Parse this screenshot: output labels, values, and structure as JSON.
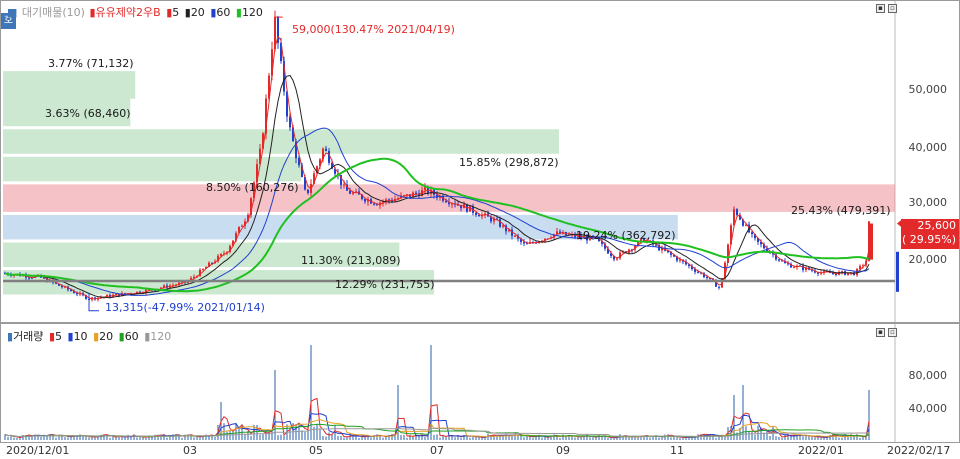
{
  "price_pane": {
    "legend": {
      "marker": "■",
      "title": "대기매물(10)",
      "stock": "유유제약2우B",
      "ma": [
        "5",
        "20",
        "60",
        "120"
      ],
      "ma_colors": [
        "#e22a2a",
        "#222222",
        "#2040d0",
        "#20c020"
      ]
    },
    "corner_label": "호",
    "y_ticks": [
      "50,000",
      "40,000",
      "30,000",
      "20,000"
    ],
    "current_price": "25,600",
    "current_change": "( 29.95%)",
    "high_annotation": "59,000(130.47% 2021/04/19)",
    "low_annotation": "13,315(-47.99% 2021/01/14)",
    "supply_zones": [
      {
        "label": "3.77% (71,132)",
        "low": 46000,
        "high": 50500,
        "width_pct": 3.77,
        "color": "green"
      },
      {
        "label": "3.63% (68,460)",
        "low": 41500,
        "high": 46000,
        "width_pct": 3.63,
        "color": "green"
      },
      {
        "label": "15.85% (298,872)",
        "low": 37000,
        "high": 41000,
        "width_pct": 15.85,
        "color": "green"
      },
      {
        "label": "8.50% (160,276)",
        "low": 32500,
        "high": 36500,
        "width_pct": 8.5,
        "color": "green"
      },
      {
        "label": "25.43% (479,391)",
        "low": 27500,
        "high": 32000,
        "width_pct": 25.43,
        "color": "red"
      },
      {
        "label": "19.24% (362,792)",
        "low": 23000,
        "high": 27000,
        "width_pct": 19.24,
        "color": "blue"
      },
      {
        "label": "11.30% (213,089)",
        "low": 18500,
        "high": 22500,
        "width_pct": 11.3,
        "color": "green"
      },
      {
        "label": "12.29% (231,755)",
        "low": 14000,
        "high": 18000,
        "width_pct": 12.29,
        "color": "green"
      }
    ]
  },
  "volume_pane": {
    "legend": {
      "title": "거래량",
      "ma": [
        "5",
        "10",
        "20",
        "60",
        "120"
      ],
      "ma_colors": [
        "#e22a2a",
        "#2040d0",
        "#e8a020",
        "#20a020",
        "#999999"
      ]
    },
    "y_ticks": [
      "80,000",
      "40,000"
    ]
  },
  "x_axis": {
    "labels": [
      "2020/12/01",
      "03",
      "05",
      "07",
      "09",
      "11",
      "2022/01",
      "2022/02/17"
    ]
  },
  "chart_data": {
    "type": "candlestick",
    "ylim": [
      10000,
      60000
    ],
    "current": 25600,
    "high": 59000,
    "low": 13315,
    "price_path": [
      [
        "2020/12/01",
        17500
      ],
      [
        "2020/12/20",
        16800
      ],
      [
        "2021/01/14",
        13315
      ],
      [
        "2021/02/10",
        14500
      ],
      [
        "2021/03/05",
        16000
      ],
      [
        "2021/03/25",
        21000
      ],
      [
        "2021/04/05",
        27000
      ],
      [
        "2021/04/12",
        38000
      ],
      [
        "2021/04/19",
        59000
      ],
      [
        "2021/04/26",
        42000
      ],
      [
        "2021/05/05",
        30000
      ],
      [
        "2021/05/14",
        38000
      ],
      [
        "2021/05/25",
        31000
      ],
      [
        "2021/06/10",
        29000
      ],
      [
        "2021/06/25",
        30000
      ],
      [
        "2021/07/05",
        31000
      ],
      [
        "2021/07/20",
        29000
      ],
      [
        "2021/08/10",
        26000
      ],
      [
        "2021/08/25",
        22000
      ],
      [
        "2021/09/10",
        24000
      ],
      [
        "2021/09/30",
        23000
      ],
      [
        "2021/10/10",
        20000
      ],
      [
        "2021/10/25",
        23000
      ],
      [
        "2021/11/10",
        20000
      ],
      [
        "2021/11/25",
        17000
      ],
      [
        "2021/12/03",
        15000
      ],
      [
        "2021/12/10",
        28000
      ],
      [
        "2021/12/20",
        23000
      ],
      [
        "2022/01/05",
        19000
      ],
      [
        "2022/01/25",
        17500
      ],
      [
        "2022/02/10",
        17500
      ],
      [
        "2022/02/16",
        19700
      ],
      [
        "2022/02/17",
        25600
      ]
    ],
    "volume_spikes": [
      [
        "2021/03/22",
        38000
      ],
      [
        "2021/04/19",
        70000
      ],
      [
        "2021/05/07",
        95000
      ],
      [
        "2021/06/21",
        55000
      ],
      [
        "2021/07/08",
        95000
      ],
      [
        "2021/12/10",
        45000
      ],
      [
        "2021/12/14",
        55000
      ],
      [
        "2022/02/17",
        50000
      ]
    ],
    "volume_ylim": [
      0,
      100000
    ]
  }
}
